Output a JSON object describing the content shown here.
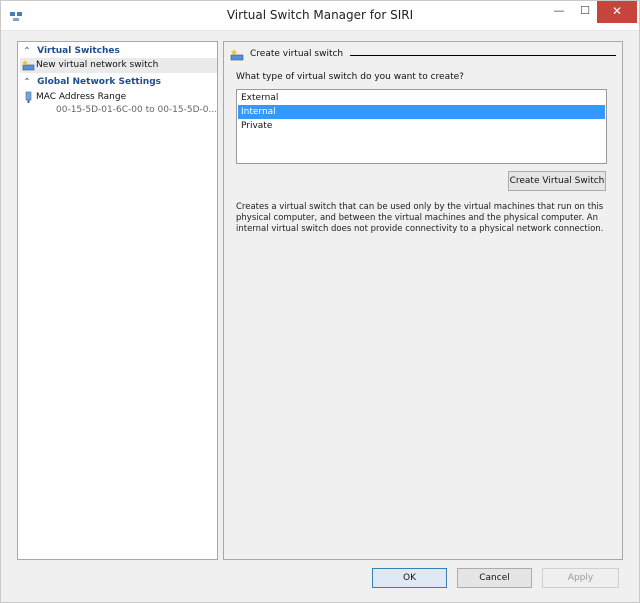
{
  "window": {
    "title": "Virtual Switch Manager for SIRI",
    "minimize_glyph": "—",
    "maximize_glyph": "☐",
    "close_glyph": "✕"
  },
  "sidebar": {
    "sections": [
      {
        "label": "Virtual Switches",
        "items": [
          {
            "label": "New virtual network switch",
            "icon": "network-switch-icon"
          }
        ]
      },
      {
        "label": "Global Network Settings",
        "items": [
          {
            "label": "MAC Address Range",
            "detail": "00-15-5D-01-6C-00 to 00-15-5D-0...",
            "icon": "mac-address-icon"
          }
        ]
      }
    ],
    "collapse_glyph": "⌃"
  },
  "main": {
    "group_label": "Create virtual switch",
    "question": "What type of virtual switch do you want to create?",
    "switch_types": [
      "External",
      "Internal",
      "Private"
    ],
    "selected_type": "Internal",
    "create_button": "Create Virtual Switch",
    "description": "Creates a virtual switch that can be used only by the virtual machines that run on this physical computer, and between the virtual machines and the physical computer. An internal virtual switch does not provide connectivity to a physical network connection."
  },
  "footer": {
    "ok": "OK",
    "cancel": "Cancel",
    "apply": "Apply"
  },
  "colors": {
    "selection": "#3399ff",
    "section_header": "#1f4e8c",
    "close_button": "#c7443d"
  }
}
